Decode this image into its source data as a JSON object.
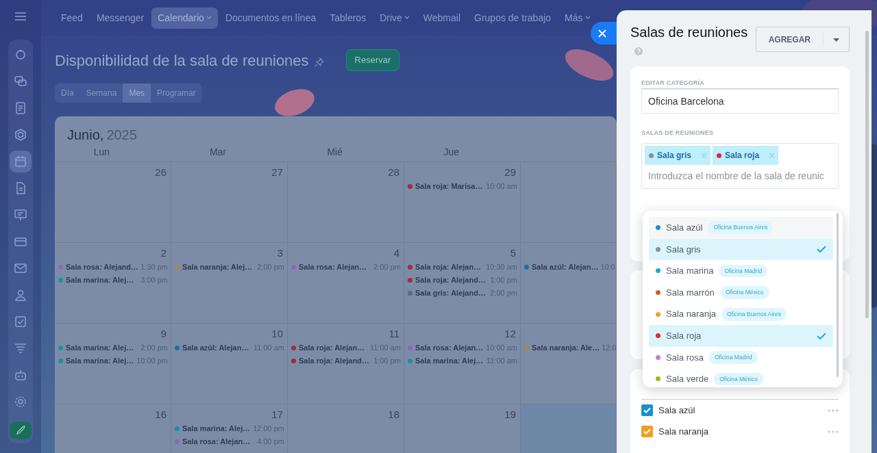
{
  "top_nav": [
    {
      "label": "Feed",
      "selected": false,
      "dropdown": false
    },
    {
      "label": "Messenger",
      "selected": false,
      "dropdown": false
    },
    {
      "label": "Calendario",
      "selected": true,
      "dropdown": true
    },
    {
      "label": "Documentos en línea",
      "selected": false,
      "dropdown": false
    },
    {
      "label": "Tableros",
      "selected": false,
      "dropdown": false
    },
    {
      "label": "Drive",
      "selected": false,
      "dropdown": true
    },
    {
      "label": "Webmail",
      "selected": false,
      "dropdown": false
    },
    {
      "label": "Grupos de trabajo",
      "selected": false,
      "dropdown": false
    },
    {
      "label": "Más",
      "selected": false,
      "dropdown": true
    }
  ],
  "sidebar": {
    "items": [
      {
        "selected": false
      },
      {
        "selected": false
      },
      {
        "selected": false
      },
      {
        "selected": false
      },
      {
        "selected": true
      },
      {
        "selected": false
      },
      {
        "selected": false
      },
      {
        "selected": false
      },
      {
        "selected": false
      },
      {
        "selected": false
      },
      {
        "selected": false
      },
      {
        "selected": false
      },
      {
        "selected": false
      },
      {
        "selected": false
      }
    ]
  },
  "page": {
    "title": "Disponibilidad de la sala de reuniones",
    "action": "Reservar"
  },
  "view_tabs": [
    {
      "label": "Día",
      "selected": false
    },
    {
      "label": "Semana",
      "selected": false
    },
    {
      "label": "Mes",
      "selected": true
    },
    {
      "label": "Programar",
      "selected": false
    }
  ],
  "calendar": {
    "month": "Junio,",
    "year": "2025",
    "weekdays": [
      "Lun",
      "Mar",
      "Mié",
      "Jue"
    ],
    "weeks": [
      {
        "days": [
          {
            "day": "26"
          },
          {
            "day": "27"
          },
          {
            "day": "28"
          },
          {
            "day": "29",
            "events": [
              {
                "text": "Sala roja: Marisa…",
                "time": "10:00 am",
                "color": "#a8283d"
              }
            ]
          },
          {
            "highlighted": false
          }
        ]
      },
      {
        "days": [
          {
            "day": "2",
            "events": [
              {
                "text": "Sala rosa: Alejand…",
                "time": "1:30 pm",
                "color": "#8a68b8"
              },
              {
                "text": "Sala marina: Alej…",
                "time": "3:00 pm",
                "color": "#1a8fa8"
              }
            ]
          },
          {
            "day": "3",
            "events": [
              {
                "text": "Sala naranja: Alej…",
                "time": "2:00 pm",
                "color": "#a8884a"
              }
            ]
          },
          {
            "day": "4",
            "events": [
              {
                "text": "Sala rosa: Alejan…",
                "time": "2:00 pm",
                "color": "#8a68b8"
              }
            ]
          },
          {
            "day": "5",
            "events": [
              {
                "text": "Sala roja: Alejan…",
                "time": "10:30 am",
                "color": "#a8283d"
              },
              {
                "text": "Sala roja: Alejand…",
                "time": "1:00 pm",
                "color": "#a8283d"
              },
              {
                "text": "Sala gris: Alejand…",
                "time": "2:00 pm",
                "color": "#5a6a88"
              }
            ]
          },
          {
            "events": [
              {
                "text": "Sala azúl: Alejan…",
                "time": "10:0",
                "color": "#1a6ea8"
              }
            ]
          }
        ]
      },
      {
        "days": [
          {
            "day": "9",
            "events": [
              {
                "text": "Sala marina: Alej…",
                "time": "2:00 pm",
                "color": "#1a8fa8"
              },
              {
                "text": "Sala marina: Alej…",
                "time": "10:00 pm",
                "color": "#1a8fa8"
              }
            ]
          },
          {
            "day": "10",
            "events": [
              {
                "text": "Sala azúl: Alejan…",
                "time": "11:00 am",
                "color": "#1a6ea8"
              }
            ]
          },
          {
            "day": "11",
            "events": [
              {
                "text": "Sala roja: Alejan…",
                "time": "11:00 am",
                "color": "#a8283d"
              },
              {
                "text": "Sala roja: Alejand…",
                "time": "1:00 pm",
                "color": "#a8283d"
              }
            ]
          },
          {
            "day": "12",
            "events": [
              {
                "text": "Sala rosa: Alejan…",
                "time": "10:00 am",
                "color": "#8a68b8"
              },
              {
                "text": "Sala marina: Alej…",
                "time": "11:00 am",
                "color": "#1a8fa8"
              }
            ]
          },
          {
            "events": [
              {
                "text": "Sala naranja: Ale…",
                "time": "12:0",
                "color": "#a8884a"
              }
            ]
          }
        ]
      },
      {
        "days": [
          {
            "day": "16"
          },
          {
            "day": "17",
            "events": [
              {
                "text": "Sala marina: Alej…",
                "time": "12:00 pm",
                "color": "#1a8fa8"
              },
              {
                "text": "Sala rosa: Alejan…",
                "time": "4:00 pm",
                "color": "#8a68b8"
              }
            ]
          },
          {
            "day": "18"
          },
          {
            "day": "19"
          },
          {
            "highlighted": true
          }
        ]
      }
    ]
  },
  "panel": {
    "title": "Salas de reuniones",
    "add_button": "AGREGAR",
    "section_label": "EDITAR CATEGORÍA",
    "category_name": "Oficina Barcelona",
    "rooms_label": "SALAS DE REUNIONES",
    "chips": [
      {
        "name": "Sala gris",
        "color": "#8a8f99"
      },
      {
        "name": "Sala roja",
        "color": "#e02a2a"
      }
    ],
    "room_input": {
      "placeholder": "Introduzca el nombre de la sala de reunic"
    },
    "dropdown": [
      {
        "name": "Sala azúl",
        "color": "#1a8fd0",
        "tag": "Oficina Buenos Aires",
        "selected": false
      },
      {
        "name": "Sala gris",
        "color": "#8a8f99",
        "selected": true
      },
      {
        "name": "Sala marina",
        "color": "#1ab0c8",
        "tag": "Oficina Madrid",
        "selected": false
      },
      {
        "name": "Sala marrón",
        "color": "#c8602a",
        "tag": "Oficina México",
        "selected": false
      },
      {
        "name": "Sala naranja",
        "color": "#f0a020",
        "tag": "Oficina Buenos Aires",
        "selected": false
      },
      {
        "name": "Sala roja",
        "color": "#e02a2a",
        "selected": true
      },
      {
        "name": "Sala rosa",
        "color": "#c87ad0",
        "tag": "Oficina Madrid",
        "selected": false
      },
      {
        "name": "Sala verde",
        "color": "#8ac020",
        "tag": "Oficina México",
        "selected": false
      }
    ],
    "room_list": [
      {
        "name": "Sala azúl",
        "color": "#1a8fd0",
        "checked": true
      },
      {
        "name": "Sala naranja",
        "color": "#f0a020",
        "checked": true
      }
    ]
  }
}
